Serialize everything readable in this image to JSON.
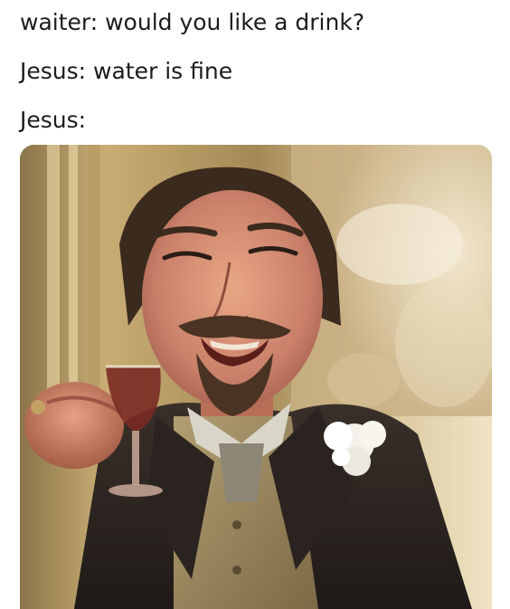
{
  "captions": [
    "waiter: would you like a drink?",
    "Jesus: water is fine",
    "Jesus:"
  ],
  "photo": {
    "icon": "laughing-man-with-wine-glass-image"
  },
  "colors": {
    "background": "#ffffff",
    "text": "#1c1c1c"
  }
}
